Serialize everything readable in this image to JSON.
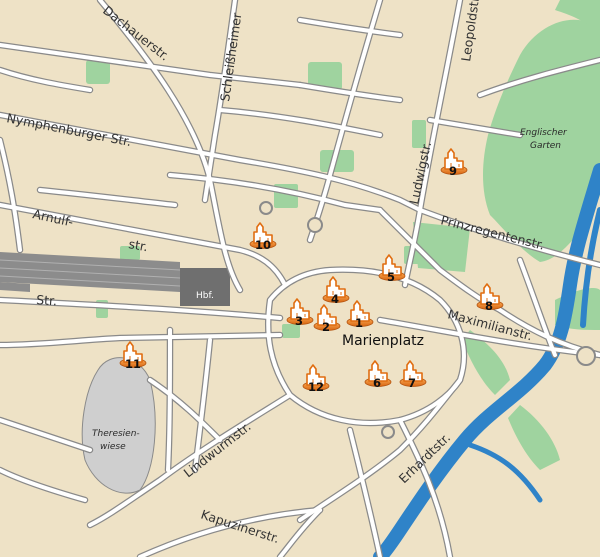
{
  "streets": {
    "dachauer": "Dachauerstr.",
    "schleissheimer": "Schleißheimer",
    "leopold": "Leopoldstr.",
    "nymphenburger": "Nymphenburger Str.",
    "ludwig": "Ludwigstr.",
    "arnulf_1": "Arnulf-",
    "arnulf_2": "str.",
    "prinzregenten": "Prinzregentenstr.",
    "bayer": "Str.",
    "maximilian": "Maximilianstr.",
    "lindwurm": "Lindwurmstr.",
    "erhardt": "Erhardtstr.",
    "kapuziner": "Kapuzinerstr."
  },
  "places": {
    "marienplatz": "Marienplatz",
    "hbf": "Hbf.",
    "englischer_garten_1": "Englischer",
    "englischer_garten_2": "Garten",
    "theresienwiese_1": "Theresien-",
    "theresienwiese_2": "wiese"
  },
  "markers": [
    {
      "id": "marker-1",
      "number": "1"
    },
    {
      "id": "marker-2",
      "number": "2"
    },
    {
      "id": "marker-3",
      "number": "3"
    },
    {
      "id": "marker-4",
      "number": "4"
    },
    {
      "id": "marker-5",
      "number": "5"
    },
    {
      "id": "marker-6",
      "number": "6"
    },
    {
      "id": "marker-7",
      "number": "7"
    },
    {
      "id": "marker-8",
      "number": "8"
    },
    {
      "id": "marker-9",
      "number": "9"
    },
    {
      "id": "marker-10",
      "number": "10"
    },
    {
      "id": "marker-11",
      "number": "11"
    },
    {
      "id": "marker-12",
      "number": "12"
    }
  ],
  "colors": {
    "background": "#eee2c6",
    "road_casing": "#8a8a8a",
    "road_fill": "#ffffff",
    "park": "#9fd39f",
    "river": "#2f83c8",
    "rail": "#8c8c8c",
    "marker": "#ef7d1a"
  }
}
